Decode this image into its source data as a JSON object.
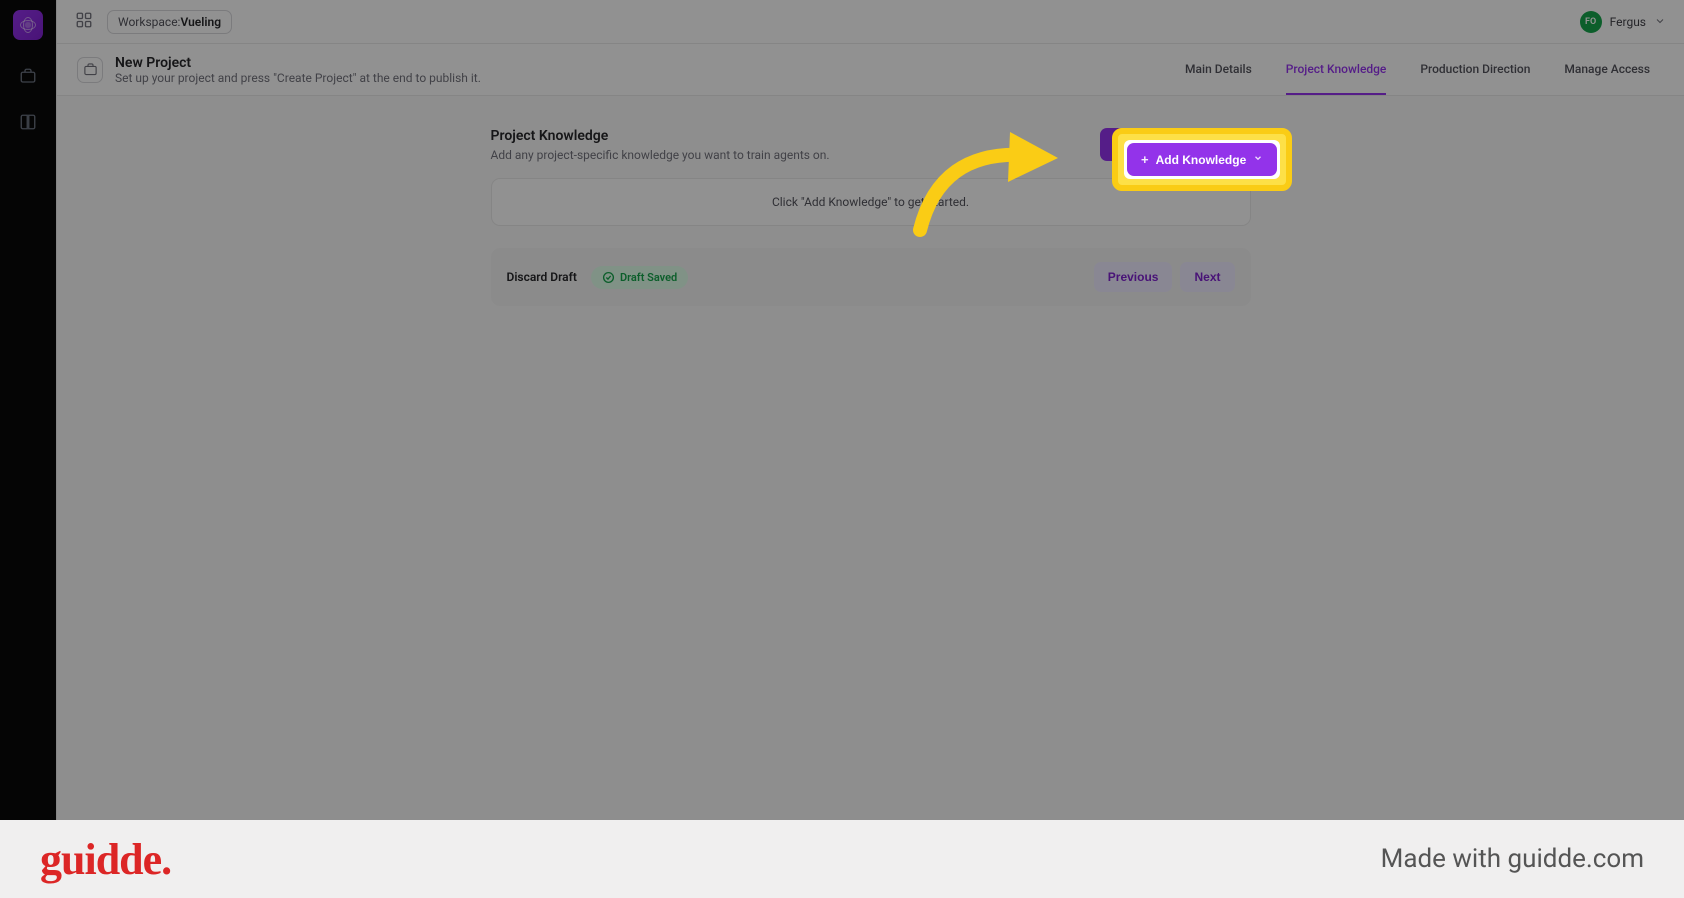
{
  "topbar": {
    "workspace_label": "Workspace:",
    "workspace_name": "Vueling",
    "user_initials": "FO",
    "user_name": "Fergus"
  },
  "header": {
    "title": "New Project",
    "subtitle": "Set up your project and press \"Create Project\" at the end to publish it."
  },
  "tabs": {
    "items": [
      {
        "label": "Main Details"
      },
      {
        "label": "Project Knowledge"
      },
      {
        "label": "Production Direction"
      },
      {
        "label": "Manage Access"
      }
    ],
    "active_index": 1
  },
  "section": {
    "title": "Project Knowledge",
    "desc": "Add any project-specific knowledge you want to train agents on.",
    "add_button": "Add Knowledge",
    "empty_message": "Click \"Add Knowledge\" to get started."
  },
  "footer": {
    "discard": "Discard Draft",
    "saved": "Draft Saved",
    "previous": "Previous",
    "next": "Next"
  },
  "guidde": {
    "logo": "guidde.",
    "made": "Made with guidde.com"
  },
  "colors": {
    "accent": "#9333ea",
    "highlight": "#facc15",
    "success": "#16a34a",
    "danger": "#dc2626"
  }
}
